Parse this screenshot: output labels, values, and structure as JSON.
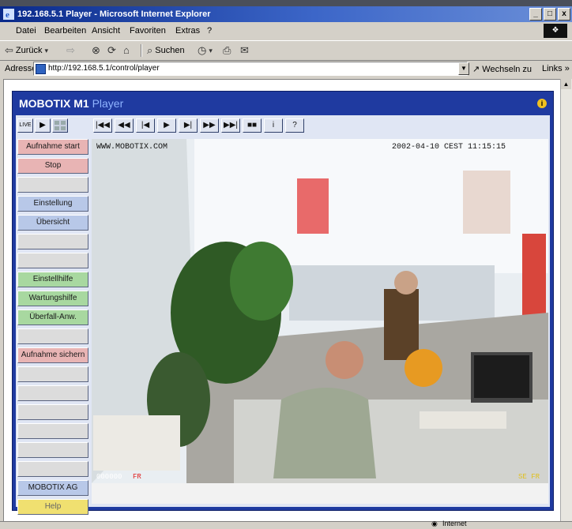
{
  "window": {
    "title": "192.168.5.1 Player - Microsoft Internet Explorer",
    "controls": [
      "_",
      "□",
      "x"
    ]
  },
  "menu": [
    "Datei",
    "Bearbeiten",
    "Ansicht",
    "Favoriten",
    "Extras",
    "?"
  ],
  "toolbar": {
    "back_label": "Zurück",
    "search_label": "Suchen"
  },
  "address": {
    "label": "Adresse",
    "url": "http://192.168.5.1/control/player",
    "go_label": "Wechseln zu",
    "links_label": "Links »"
  },
  "player": {
    "brand": "MOBOTIX M1",
    "brand_sub": "Player",
    "mode_live": "LIVE",
    "controls": [
      "|◀◀",
      "◀◀",
      "|◀",
      "▶",
      "▶|",
      "▶▶",
      "▶▶|",
      "■■",
      "i",
      "?"
    ],
    "side_buttons": [
      {
        "label": "Aufnahme start",
        "style": "pink"
      },
      {
        "label": "Stop",
        "style": "pink"
      },
      {
        "label": "",
        "style": "gray"
      },
      {
        "label": "Einstellung",
        "style": "blue"
      },
      {
        "label": "Übersicht",
        "style": "blue"
      },
      {
        "label": "",
        "style": "gray"
      },
      {
        "label": "",
        "style": "gray"
      },
      {
        "label": "Einstellhilfe",
        "style": "green"
      },
      {
        "label": "Wartungshilfe",
        "style": "green"
      },
      {
        "label": "Überfall-Anw.",
        "style": "green"
      },
      {
        "label": "",
        "style": "gray"
      },
      {
        "label": "Aufnahme sichern",
        "style": "pink"
      },
      {
        "label": "",
        "style": "gray"
      },
      {
        "label": "",
        "style": "gray"
      },
      {
        "label": "",
        "style": "gray"
      },
      {
        "label": "",
        "style": "gray"
      },
      {
        "label": "",
        "style": "gray"
      },
      {
        "label": "",
        "style": "gray"
      },
      {
        "label": "MOBOTIX AG",
        "style": "blue"
      },
      {
        "label": "Help",
        "style": "yellow"
      }
    ],
    "overlay_top_left": "WWW.MOBOTIX.COM",
    "overlay_top_right": "2002-04-10 CEST 11:15:15",
    "overlay_bottom_left": "000000",
    "overlay_bottom_left_tag": "FR",
    "overlay_bottom_right": "SE FR"
  },
  "statusbar": {
    "zone": "Internet"
  },
  "colors": {
    "player_frame": "#1f3aa0",
    "titlebar_start": "#0a2a8a"
  }
}
